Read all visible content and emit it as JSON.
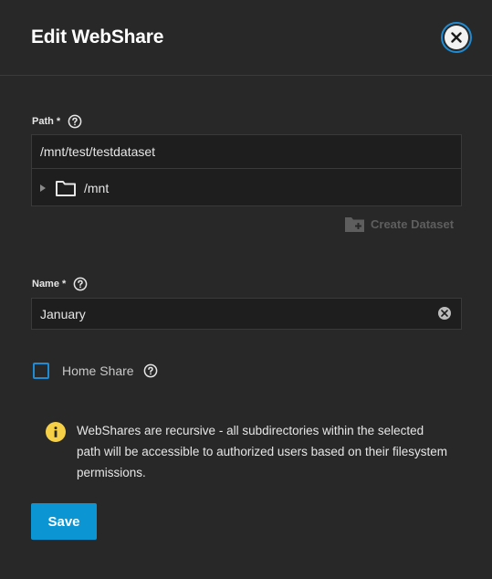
{
  "dialog": {
    "title": "Edit WebShare",
    "close_icon": "close-icon"
  },
  "path": {
    "label": "Path *",
    "value": "/mnt/test/testdataset",
    "tree_root": "/mnt",
    "create_dataset_label": "Create Dataset"
  },
  "name": {
    "label": "Name *",
    "value": "January"
  },
  "home_share": {
    "label": "Home Share",
    "checked": false
  },
  "info": {
    "text": "WebShares are recursive - all subdirectories within the selected path will be accessible to authorized users based on their filesystem permissions."
  },
  "actions": {
    "save_label": "Save"
  },
  "colors": {
    "accent": "#0c95d3",
    "warning": "#f6d046",
    "background": "#282828"
  }
}
